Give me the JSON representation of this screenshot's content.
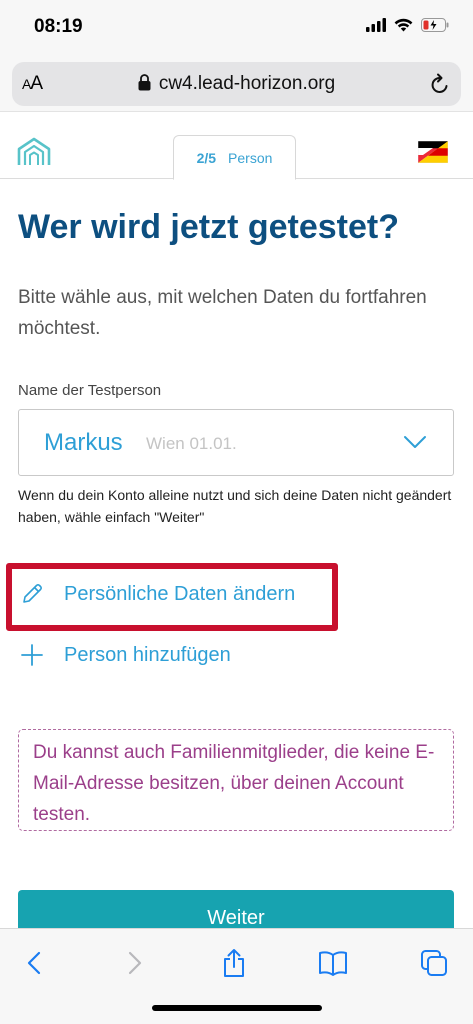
{
  "status_bar": {
    "time": "08:19"
  },
  "browser": {
    "aa_label_small": "A",
    "aa_label_big": "A",
    "url": "cw4.lead-horizon.org"
  },
  "header": {
    "step_number": "2/5",
    "step_label": "Person"
  },
  "main": {
    "title": "Wer wird jetzt getestet?",
    "intro": "Bitte wähle aus, mit welchen Daten du fortfahren möchtest.",
    "field_label": "Name der Testperson",
    "selected_person": {
      "name": "Markus",
      "meta": "Wien  01.01."
    },
    "hint": "Wenn du dein Konto alleine nutzt und sich deine Daten nicht geändert haben, wähle einfach \"Weiter\"",
    "edit_link": "Persönliche Daten ändern",
    "add_link": "Person hinzufügen",
    "info_text": "Du kannst auch Familienmitglieder, die keine E-Mail-Adresse besitzen, über deinen Account testen.",
    "continue_label": "Weiter"
  },
  "colors": {
    "title": "#0d4f80",
    "link": "#2e9fd6",
    "highlight": "#c8102e",
    "info": "#9b3f8a",
    "button": "#17a3b0"
  }
}
